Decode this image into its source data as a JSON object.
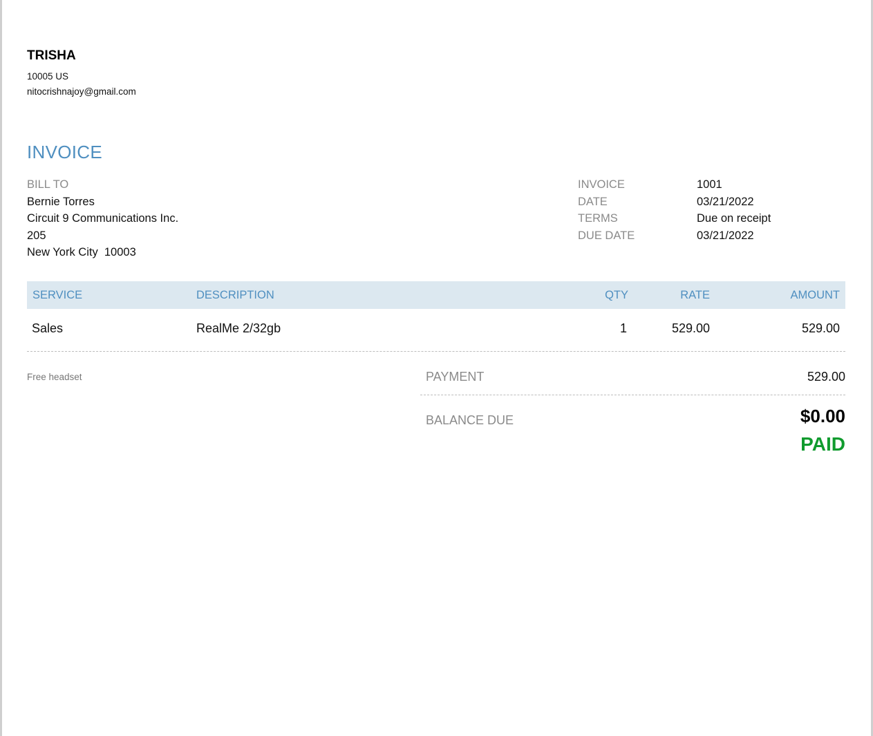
{
  "sender": {
    "name": "TRISHA",
    "address": "10005 US",
    "email": "nitocrishnajoy@gmail.com"
  },
  "title": "INVOICE",
  "bill_to": {
    "label": "BILL TO",
    "name": "Bernie Torres",
    "company": "Circuit 9 Communications Inc.",
    "street": "205",
    "city_zip": "New York City  10003"
  },
  "meta": {
    "invoice_label": "INVOICE",
    "invoice_value": "1001",
    "date_label": "DATE",
    "date_value": "03/21/2022",
    "terms_label": "TERMS",
    "terms_value": "Due on receipt",
    "due_label": "DUE DATE",
    "due_value": "03/21/2022"
  },
  "table": {
    "headers": {
      "service": "SERVICE",
      "description": "DESCRIPTION",
      "qty": "QTY",
      "rate": "RATE",
      "amount": "AMOUNT"
    },
    "rows": [
      {
        "service": "Sales",
        "description": "RealMe 2/32gb",
        "qty": "1",
        "rate": "529.00",
        "amount": "529.00"
      }
    ]
  },
  "note": "Free headset",
  "totals": {
    "payment_label": "PAYMENT",
    "payment_value": "529.00",
    "balance_label": "BALANCE DUE",
    "balance_value": "$0.00",
    "status": "PAID"
  },
  "colors": {
    "accent": "#4f8fc0",
    "header_bg": "#dce8f0",
    "paid": "#109b2e"
  }
}
